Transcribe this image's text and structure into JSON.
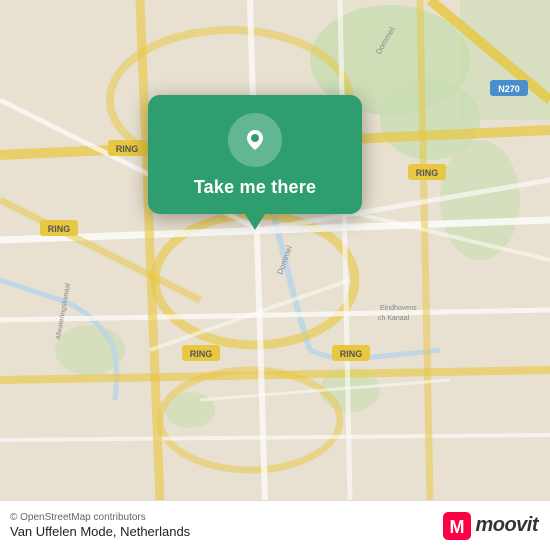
{
  "map": {
    "alt": "Map of Eindhoven, Netherlands"
  },
  "popup": {
    "button_label": "Take me there",
    "icon_name": "location-pin-icon"
  },
  "bottom_bar": {
    "copyright": "© OpenStreetMap contributors",
    "location_name": "Van Uffelen Mode, Netherlands",
    "logo_text": "moovit"
  },
  "colors": {
    "map_green": "#2e9e6e",
    "road_yellow": "#f5d76e",
    "road_white": "#ffffff",
    "land": "#e8e0d0",
    "water": "#c0d8e8",
    "park": "#c8e0b0"
  }
}
